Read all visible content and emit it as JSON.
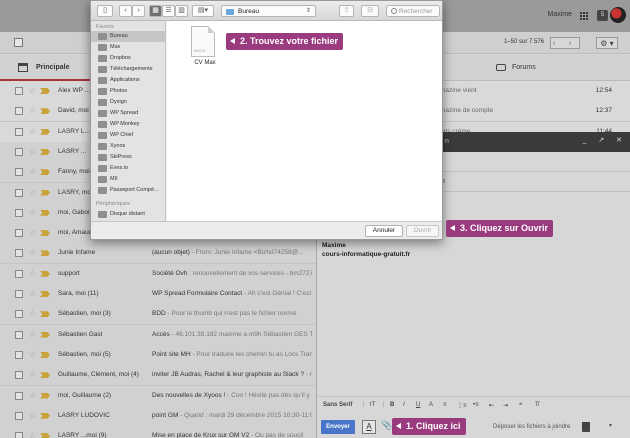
{
  "gmail": {
    "user_name": "Maxime",
    "notification_count": "5",
    "pagination": "1–50 sur 7 576",
    "pager_icons": "‹ ›",
    "gear_icon": "⚙ ▾",
    "tabs": {
      "principal": "Principale",
      "forums": "Forums"
    },
    "rows": [
      {
        "sender": "Alex WP ...",
        "subject": "",
        "preview": "",
        "right_text": "mazine vient",
        "time": "12:54",
        "read": false
      },
      {
        "sender": "David, moi",
        "subject": "",
        "preview": "",
        "right_text": "mazine de compte",
        "time": "12:37",
        "read": false
      },
      {
        "sender": "LASRY L...",
        "subject": "",
        "preview": "",
        "right_text": "ons crème",
        "time": "11:44",
        "read": false
      },
      {
        "sender": "LASRY ...",
        "subject": "",
        "preview": "",
        "right_text": "",
        "time": "",
        "read": true
      },
      {
        "sender": "Fanny, moi",
        "subject": "",
        "preview": "",
        "right_text": "",
        "time": "",
        "read": true
      },
      {
        "sender": "LASRY, moi",
        "subject": "",
        "preview": "",
        "right_text": "",
        "time": "",
        "read": true
      },
      {
        "sender": "moi, Gaboi",
        "subject": "",
        "preview": "",
        "right_text": "",
        "time": "",
        "read": true
      },
      {
        "sender": "moi, Amaur",
        "subject": "",
        "preview": "",
        "right_text": "",
        "time": "",
        "read": true
      },
      {
        "sender": "Junie Infame",
        "subject": "(aucun objet)",
        "preview": " - From: Junie Infame <Bizhd74258@...",
        "right_text": "",
        "time": "",
        "read": true
      },
      {
        "sender": "support",
        "subject": "Société Ovh",
        "preview": " : renouvellement de vos services - bm27270",
        "right_text": "",
        "time": "",
        "read": true
      },
      {
        "sender": "Sara, moi (11)",
        "subject": "WP Spread Formulaire Contact",
        "preview": " - Ah c'est Génial ! C'est p",
        "right_text": "",
        "time": "",
        "read": true
      },
      {
        "sender": "Sébastien, moi (3)",
        "subject": "BDD",
        "preview": " - Pour le thumb qui n'est pas le fichier normé",
        "right_text": "",
        "time": "",
        "read": true
      },
      {
        "sender": "Sébastien Gast",
        "subject": "Accès",
        "preview": " - 46.101.39.182 maxime a m9h Sébastien GES T",
        "right_text": "",
        "time": "",
        "read": true
      },
      {
        "sender": "Sébastien, moi (5)",
        "subject": "Point site MH",
        "preview": " - Pour traduire les chemin tu as Locs Tran",
        "right_text": "",
        "time": "",
        "read": true
      },
      {
        "sender": "Guillaume, Clément, moi (4)",
        "subject": "inviter JB Audras, Rachel & leur graphiste au Slack ?",
        "preview": " - m",
        "right_text": "",
        "time": "",
        "read": true
      },
      {
        "sender": "moi, Guillaume (2)",
        "subject": "Des nouvelles de Xyoos !",
        "preview": " - Coo ! Hésite pas dès qu'il y a",
        "right_text": "",
        "time": "",
        "read": true
      },
      {
        "sender": "LASRY LUDOVIC",
        "subject": "point GM",
        "preview": " - Quand : mardi 29 décembre 2015 10:30-11:00",
        "right_text": "",
        "time": "",
        "read": true
      },
      {
        "sender": "LASRY ...moi (9)",
        "subject": "Mise en place de Krux sur GM V2",
        "preview": " - Ou pas de soucil",
        "right_text": "",
        "time": "",
        "read": true
      }
    ]
  },
  "compose": {
    "header_text": "n",
    "to_text": "",
    "subject_text": "h",
    "signature_name": "Maxime",
    "signature_site": "cours-informatique-gratuit.fr",
    "font_select": "Sans Serif",
    "font_size": "тT",
    "format_b": "B",
    "format_i": "I",
    "format_u": "U",
    "format_a": "A",
    "format_align": "≡",
    "format_ol": "⋮≡",
    "format_ul": "•≡",
    "format_outdent": "⇤",
    "format_indent": "⇥",
    "format_quote": "❝",
    "format_clear": "T̸",
    "send_label": "Envoyer",
    "text_format_icon": "A",
    "attach_icon": "📎",
    "drop_label": "Déposer les fichiers à joindre",
    "more_icon": "▾",
    "window_controls": "_ ↗ ✕"
  },
  "dialog": {
    "location": "Bureau",
    "search_placeholder": "Rechercher",
    "nav_back": "‹",
    "nav_forward": "›",
    "sidebar_toggle": "▯",
    "view_icons": "▦",
    "view_list": "☰",
    "view_columns": "▥",
    "view_cover": "▤▾",
    "share_icon": "⇪",
    "tag_icon": "⊟",
    "favorites_header": "Favoris",
    "favorites": [
      "Bureau",
      "Max",
      "Dropbox",
      "Téléchargements",
      "Applications",
      "Photos",
      "Dysign",
      "WP Spread",
      "WP Monkey",
      "WP Chief",
      "Xyoos",
      "SkiPress",
      "Eves.io",
      "MII",
      "Passeport Compé..."
    ],
    "devices_header": "Périphériques",
    "devices": [
      "Disque distant"
    ],
    "file_name": "CV Max",
    "file_ext": "DOCX",
    "cancel_label": "Annuler",
    "open_label": "Ouvrir"
  },
  "callouts": {
    "step1": "1. Cliquez ici",
    "step2": "2. Trouvez votre fichier",
    "step3": "3. Cliquez sur Ouvrir"
  },
  "colors": {
    "callout": "#9a3b7f",
    "send_button": "#4a76c9",
    "folder": "#6aa7e0"
  }
}
